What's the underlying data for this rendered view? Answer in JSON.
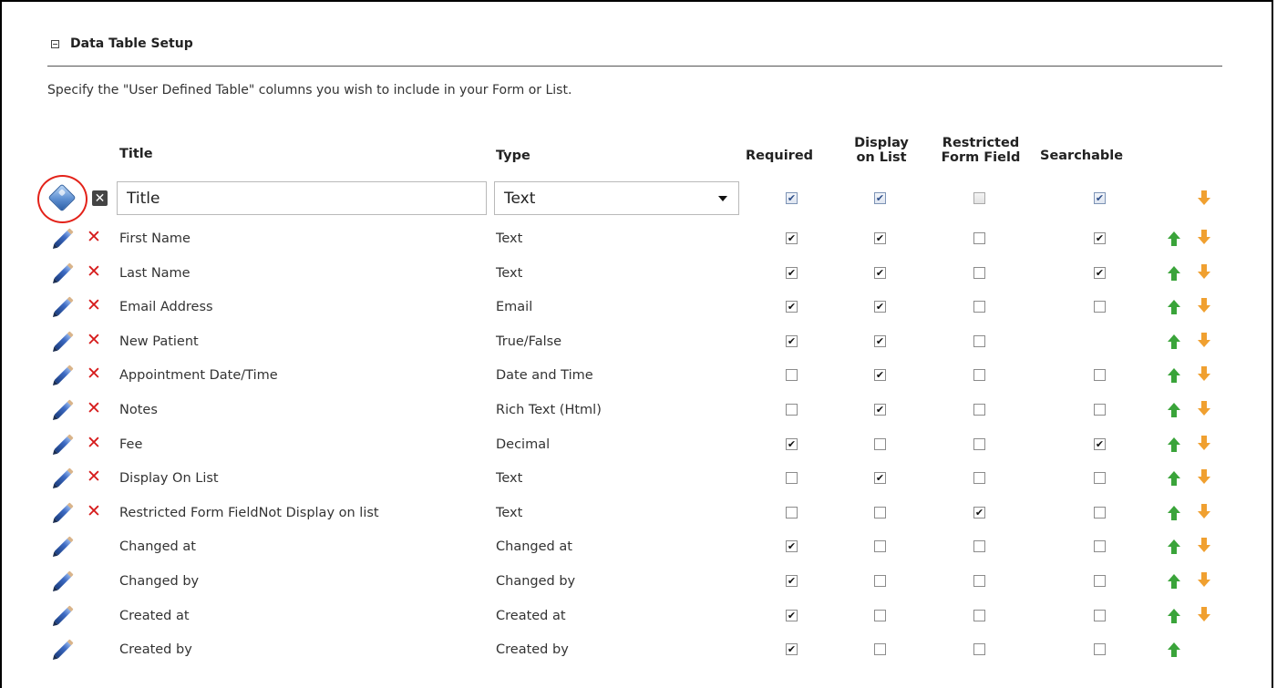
{
  "section": {
    "title": "Data Table Setup",
    "description": "Specify the \"User Defined Table\" columns you wish to include in your Form or List."
  },
  "headers": {
    "title": "Title",
    "type": "Type",
    "required": "Required",
    "display_line1": "Display",
    "display_line2": "on List",
    "restricted_line1": "Restricted",
    "restricted_line2": "Form Field",
    "searchable": "Searchable"
  },
  "edit_row": {
    "title_value": "Title",
    "type_value": "Text",
    "required": true,
    "display": true,
    "restricted": false,
    "searchable": true
  },
  "rows": [
    {
      "title": "First Name",
      "type": "Text",
      "deletable": true,
      "required": true,
      "display": true,
      "restricted": false,
      "searchable": true,
      "up": true,
      "down": true
    },
    {
      "title": "Last Name",
      "type": "Text",
      "deletable": true,
      "required": true,
      "display": true,
      "restricted": false,
      "searchable": true,
      "up": true,
      "down": true
    },
    {
      "title": "Email Address",
      "type": "Email",
      "deletable": true,
      "required": true,
      "display": true,
      "restricted": false,
      "searchable": false,
      "up": true,
      "down": true
    },
    {
      "title": "New Patient",
      "type": "True/False",
      "deletable": true,
      "required": true,
      "display": true,
      "restricted": false,
      "searchable": null,
      "up": true,
      "down": true
    },
    {
      "title": "Appointment Date/Time",
      "type": "Date and Time",
      "deletable": true,
      "required": false,
      "display": true,
      "restricted": false,
      "searchable": false,
      "up": true,
      "down": true
    },
    {
      "title": "Notes",
      "type": "Rich Text (Html)",
      "deletable": true,
      "required": false,
      "display": true,
      "restricted": false,
      "searchable": false,
      "up": true,
      "down": true
    },
    {
      "title": "Fee",
      "type": "Decimal",
      "deletable": true,
      "required": true,
      "display": false,
      "restricted": false,
      "searchable": true,
      "up": true,
      "down": true
    },
    {
      "title": "Display On List",
      "type": "Text",
      "deletable": true,
      "required": false,
      "display": true,
      "restricted": false,
      "searchable": false,
      "up": true,
      "down": true
    },
    {
      "title": "Restricted Form FieldNot Display on list",
      "type": "Text",
      "deletable": true,
      "required": false,
      "display": false,
      "restricted": true,
      "searchable": false,
      "up": true,
      "down": true
    },
    {
      "title": "Changed at",
      "type": "Changed at",
      "deletable": false,
      "required": true,
      "display": false,
      "restricted": false,
      "searchable": false,
      "up": true,
      "down": true
    },
    {
      "title": "Changed by",
      "type": "Changed by",
      "deletable": false,
      "required": true,
      "display": false,
      "restricted": false,
      "searchable": false,
      "up": true,
      "down": true
    },
    {
      "title": "Created at",
      "type": "Created at",
      "deletable": false,
      "required": true,
      "display": false,
      "restricted": false,
      "searchable": false,
      "up": true,
      "down": true
    },
    {
      "title": "Created by",
      "type": "Created by",
      "deletable": false,
      "required": true,
      "display": false,
      "restricted": false,
      "searchable": false,
      "up": true,
      "down": false
    }
  ],
  "icons": {
    "collapse": "collapse-minus-icon",
    "save": "diamond-save-icon",
    "cancel": "close-icon",
    "edit": "pencil-icon",
    "delete": "delete-x-icon",
    "move_up": "arrow-up-icon",
    "move_down": "arrow-down-icon"
  },
  "colors": {
    "highlight": "#e32219",
    "delete": "#d61b1b",
    "up_arrow": "#3aa43a",
    "down_arrow": "#f0a030"
  }
}
